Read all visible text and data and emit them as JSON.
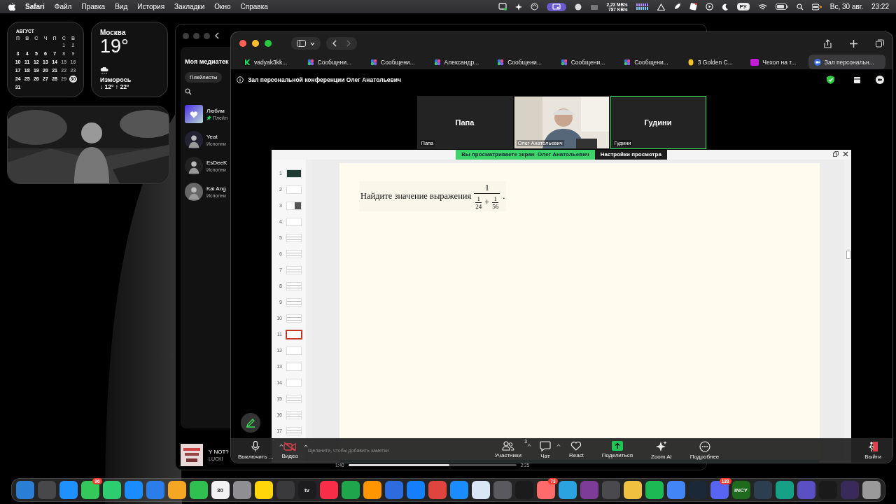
{
  "menu_bar": {
    "app": "Safari",
    "menus": [
      "Файл",
      "Правка",
      "Вид",
      "История",
      "Закладки",
      "Окно",
      "Справка"
    ],
    "net_up": "2,23 MB/s",
    "net_down": "787 KB/s",
    "input_source": "РУ",
    "date": "Вс, 30 авг.",
    "time": "23:22"
  },
  "calendar_widget": {
    "month": "АВГУСТ",
    "weekdays": [
      "П",
      "В",
      "С",
      "Ч",
      "П",
      "С",
      "В"
    ],
    "weeks": [
      {
        "days": [
          {
            "day": "1",
            "selected": false
          },
          {
            "day": "2",
            "selected": false
          }
        ]
      },
      {
        "days": [
          {
            "day": "3",
            "selected": false
          },
          {
            "day": "4",
            "selected": false
          },
          {
            "day": "5",
            "selected": false
          },
          {
            "day": "6",
            "selected": false
          },
          {
            "day": "7",
            "selected": false
          },
          {
            "day": "8",
            "selected": false
          },
          {
            "day": "9",
            "selected": false
          }
        ]
      },
      {
        "days": [
          {
            "day": "10",
            "selected": false
          },
          {
            "day": "11",
            "selected": false
          },
          {
            "day": "12",
            "selected": false
          },
          {
            "day": "13",
            "selected": false
          },
          {
            "day": "14",
            "selected": false
          },
          {
            "day": "15",
            "selected": false
          },
          {
            "day": "16",
            "selected": false
          }
        ]
      },
      {
        "days": [
          {
            "day": "17",
            "selected": false
          },
          {
            "day": "18",
            "selected": false
          },
          {
            "day": "19",
            "selected": false
          },
          {
            "day": "20",
            "selected": false
          },
          {
            "day": "21",
            "selected": false
          },
          {
            "day": "22",
            "selected": false
          },
          {
            "day": "23",
            "selected": false
          }
        ]
      },
      {
        "days": [
          {
            "day": "24",
            "selected": false
          },
          {
            "day": "25",
            "selected": false
          },
          {
            "day": "26",
            "selected": false
          },
          {
            "day": "27",
            "selected": false
          },
          {
            "day": "28",
            "selected": false
          },
          {
            "day": "29",
            "selected": false
          },
          {
            "day": "30",
            "selected": true
          }
        ]
      },
      {
        "days": [
          {
            "day": "31",
            "selected": false
          }
        ]
      }
    ]
  },
  "weather_widget": {
    "city": "Москва",
    "temperature": "19°",
    "condition": "Изморось",
    "range": "↓ 12° ↑ 22°"
  },
  "music_app": {
    "title": "Моя медиатек",
    "filter": "Плейлисты",
    "items": [
      {
        "title": "Любим",
        "subtitle": "Плейл",
        "kind": "liked"
      },
      {
        "title": "Yeat",
        "subtitle": "Исполни",
        "kind": "artist"
      },
      {
        "title": "EsDeeK",
        "subtitle": "Исполни",
        "kind": "artist"
      },
      {
        "title": "Kai Ang",
        "subtitle": "Исполни",
        "kind": "artist"
      }
    ],
    "player": {
      "track": "Y NOT?",
      "artist": "LUCKI",
      "elapsed": "1:40",
      "total": "2:25",
      "level": 0.6
    }
  },
  "browser": {
    "tabs": [
      {
        "title": "vadyak3kk...",
        "kind": "k",
        "selected": false
      },
      {
        "title": "Сообщени...",
        "kind": "dots",
        "selected": false
      },
      {
        "title": "Сообщени...",
        "kind": "dots",
        "selected": false
      },
      {
        "title": "Александр...",
        "kind": "dots",
        "selected": false
      },
      {
        "title": "Сообщени...",
        "kind": "dots",
        "selected": false
      },
      {
        "title": "Сообщени...",
        "kind": "dots",
        "selected": false
      },
      {
        "title": "Сообщени...",
        "kind": "dots",
        "selected": false
      },
      {
        "title": "3 Golden C...",
        "kind": "coin",
        "selected": false
      },
      {
        "title": "Чехол на т...",
        "kind": "wb",
        "selected": false
      },
      {
        "title": "Зал персональн...",
        "kind": "zoom",
        "selected": true
      }
    ],
    "page_title": "Зал персональной конференции Олег Анатольевич"
  },
  "meeting": {
    "participants": [
      {
        "name": "Папа",
        "label": "Папа",
        "kind": "avatar",
        "selected": false
      },
      {
        "label": "Олег Анатольевич",
        "kind": "video",
        "selected": false
      },
      {
        "name": "Гудини",
        "label": "Гудини",
        "kind": "avatar",
        "selected": true
      }
    ],
    "share_banner": {
      "text": "Вы просматриваете экран  Олег Анатольевич",
      "settings": "Настройки просмотра"
    },
    "presentation": {
      "slides": [
        {
          "number": "1",
          "kind": "title",
          "selected": false
        },
        {
          "number": "2",
          "kind": "blank",
          "selected": false
        },
        {
          "number": "3",
          "selected": false
        },
        {
          "number": "4",
          "kind": "blank",
          "selected": false
        },
        {
          "number": "5",
          "kind": "text",
          "selected": false
        },
        {
          "number": "6",
          "kind": "text",
          "selected": false
        },
        {
          "number": "7",
          "kind": "text",
          "selected": false
        },
        {
          "number": "8",
          "kind": "text",
          "selected": false
        },
        {
          "number": "9",
          "kind": "text",
          "selected": false
        },
        {
          "number": "10",
          "kind": "text",
          "selected": false
        },
        {
          "number": "11",
          "kind": "blank",
          "selected": true
        },
        {
          "number": "12",
          "kind": "blank",
          "selected": false
        },
        {
          "number": "13",
          "kind": "blank",
          "selected": false
        },
        {
          "number": "14",
          "kind": "blank",
          "selected": false
        },
        {
          "number": "15",
          "kind": "text",
          "selected": false
        },
        {
          "number": "16",
          "kind": "text",
          "selected": false
        },
        {
          "number": "17",
          "kind": "text",
          "selected": false
        }
      ],
      "problem": {
        "text": "Найдите значение выражения",
        "numerator": "1",
        "terms": [
          {
            "numerator": "1",
            "denominator": "24"
          },
          {
            "numerator": "1",
            "denominator": "56"
          }
        ],
        "operator": "+",
        "end": "."
      },
      "notes": "Щелкните, чтобы добавить заметки"
    },
    "toolbar": [
      {
        "kind": "mic",
        "label": "Выключить ...",
        "caret": true
      },
      {
        "kind": "video",
        "label": "Видео",
        "caret": true
      },
      {
        "kind": "participants",
        "label": "Участники",
        "count": "3",
        "caret": true
      },
      {
        "kind": "chat",
        "label": "Чат",
        "caret": true
      },
      {
        "kind": "react",
        "label": "React",
        "caret": false
      },
      {
        "kind": "share",
        "label": "Поделиться",
        "caret": false
      },
      {
        "kind": "ai",
        "label": "Zoom AI",
        "caret": false
      },
      {
        "kind": "more",
        "label": "Подробнее",
        "caret": false
      },
      {
        "kind": "leave",
        "label": "Выйти",
        "caret": false
      }
    ]
  },
  "dock": [
    {
      "color": "#2a7fd4"
    },
    {
      "color": "#48484a"
    },
    {
      "color": "#1e90ff"
    },
    {
      "color": "#34c759",
      "badge": "96"
    },
    {
      "color": "#2ecc71"
    },
    {
      "color": "#1a8cff"
    },
    {
      "color": "#2b7de9"
    },
    {
      "color": "#f5a623"
    },
    {
      "color": "#30c050"
    },
    {
      "color": "#f2f2f2",
      "label": "30"
    },
    {
      "color": "#8e8e93"
    },
    {
      "color": "#ffd60a"
    },
    {
      "color": "#3a3a3c"
    },
    {
      "color": "#1c1c1e",
      "label": "tv"
    },
    {
      "color": "#fa2d48"
    },
    {
      "color": "#1fa64b"
    },
    {
      "color": "#ff9500"
    },
    {
      "color": "#2d6cdf"
    },
    {
      "color": "#147efb"
    },
    {
      "color": "#e0443e"
    },
    {
      "color": "#1a8cff"
    },
    {
      "color": "#d9e6f5"
    },
    {
      "color": "#5a5a5e"
    },
    {
      "color": "#1b1b1b"
    },
    {
      "color": "#ff6b6b",
      "badge": "73"
    },
    {
      "color": "#2aa3e0"
    },
    {
      "color": "#7d3c98"
    },
    {
      "color": "#4a4a4e"
    },
    {
      "color": "#f0c040"
    },
    {
      "color": "#1db954"
    },
    {
      "color": "#4285f4"
    },
    {
      "color": "#1b2838"
    },
    {
      "color": "#5865f2",
      "badge": "138"
    },
    {
      "color": "#1e6b1e",
      "label": "INCY"
    },
    {
      "color": "#2c3e50"
    },
    {
      "color": "#16a085"
    },
    {
      "color": "#5b4fc4"
    },
    {
      "color": "#1a1a1a"
    },
    {
      "color": "#3a2a5a"
    },
    {
      "color": "#9a9a9a"
    }
  ]
}
